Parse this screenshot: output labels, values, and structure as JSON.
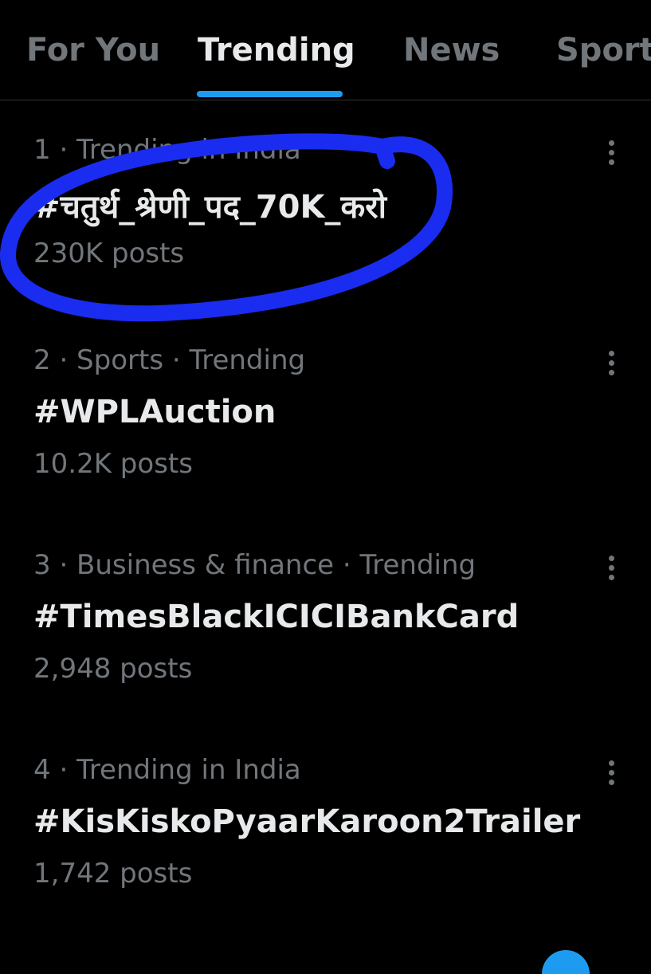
{
  "tabs": [
    {
      "label": "For You",
      "active": false
    },
    {
      "label": "Trending",
      "active": true
    },
    {
      "label": "News",
      "active": false
    },
    {
      "label": "Sport",
      "active": false
    }
  ],
  "trends": [
    {
      "meta": "1 · Trending in India",
      "tag": "#चतुर्थ_श्रेणी_पद_70K_करो",
      "posts": "230K posts",
      "highlighted": true
    },
    {
      "meta": "2 · Sports · Trending",
      "tag": "#WPLAuction",
      "posts": "10.2K posts",
      "highlighted": false
    },
    {
      "meta": "3 · Business & finance · Trending",
      "tag": "#TimesBlackICICIBankCard",
      "posts": "2,948 posts",
      "highlighted": false
    },
    {
      "meta": "4 · Trending in India",
      "tag": "#KisKiskoPyaarKaroon2Trailer",
      "posts": "1,742 posts",
      "highlighted": false
    }
  ],
  "icons": {
    "more": "more-vertical-icon"
  },
  "colors": {
    "background": "#000000",
    "accent": "#1d9bf0",
    "annotation": "#1a2cf0",
    "primary_text": "#e7e9ea",
    "secondary_text": "#71767b"
  }
}
